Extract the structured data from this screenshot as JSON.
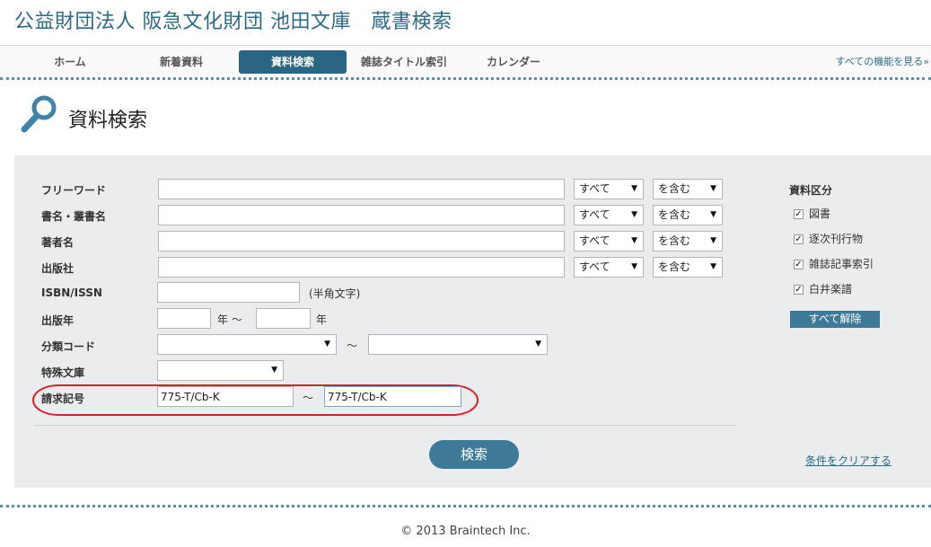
{
  "site": {
    "title": "公益財団法人 阪急文化財団 池田文庫　蔵書検索"
  },
  "nav": {
    "items": [
      {
        "label": "ホーム"
      },
      {
        "label": "新着資料"
      },
      {
        "label": "資料検索"
      },
      {
        "label": "雑誌タイトル索引"
      },
      {
        "label": "カレンダー"
      }
    ],
    "active": "資料検索",
    "more": "すべての機能を見る»"
  },
  "page": {
    "heading": "資料検索",
    "heading_icon": "search-icon"
  },
  "form": {
    "freeword": {
      "label": "フリーワード",
      "value": "",
      "scope": "すべて",
      "match": "を含む"
    },
    "title": {
      "label": "書名・叢書名",
      "value": "",
      "scope": "すべて",
      "match": "を含む"
    },
    "author": {
      "label": "著者名",
      "value": "",
      "scope": "すべて",
      "match": "を含む"
    },
    "publisher": {
      "label": "出版社",
      "value": "",
      "scope": "すべて",
      "match": "を含む"
    },
    "isbn": {
      "label": "ISBN/ISSN",
      "value": "",
      "note": "(半角文字)"
    },
    "year": {
      "label": "出版年",
      "from": "",
      "to": "",
      "unit": "年",
      "sep": "年 ～"
    },
    "classification": {
      "label": "分類コード",
      "from": "",
      "to": "",
      "sep": "～"
    },
    "special": {
      "label": "特殊文庫",
      "value": ""
    },
    "callno": {
      "label": "請求記号",
      "from": "775-T/Cb-K",
      "to": "775-T/Cb-K",
      "sep": "～"
    },
    "search_button": "検索",
    "clear_link": "条件をクリアする"
  },
  "categories": {
    "heading": "資料区分",
    "items": [
      {
        "label": "図書",
        "checked": true
      },
      {
        "label": "逐次刊行物",
        "checked": true
      },
      {
        "label": "雑誌記事索引",
        "checked": true
      },
      {
        "label": "白井楽譜",
        "checked": true
      }
    ],
    "clear_all": "すべて解除"
  },
  "footer": {
    "copyright": "© 2013 Braintech Inc."
  },
  "colors": {
    "accent": "#2a6682",
    "button": "#3e7a97",
    "panel": "#ebecee",
    "highlight": "#d9202a"
  }
}
